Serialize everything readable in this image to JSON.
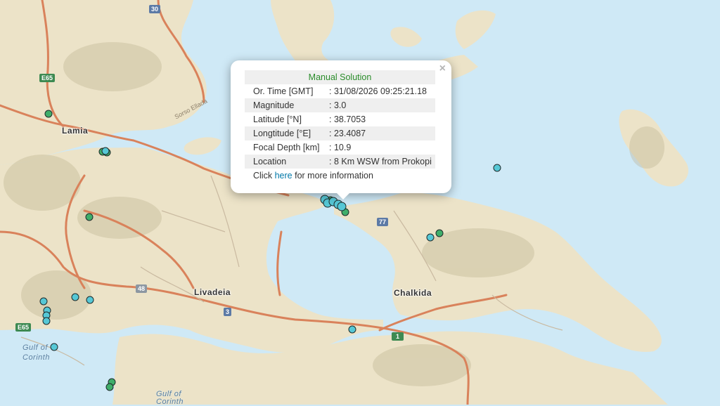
{
  "map": {
    "cities": [
      "Lamia",
      "Livadeia",
      "Chalkida"
    ],
    "water_labels": [
      "Gulf of",
      "Corinth",
      "Gulf of",
      "Corinth"
    ],
    "road_shields": [
      "30",
      "E65",
      "77",
      "3",
      "48",
      "E65",
      "1"
    ],
    "road_labels": [
      "Sorso Ellada"
    ],
    "marker_colors": {
      "green": "#3fae6a",
      "cyan": "#56c8d6"
    }
  },
  "popup": {
    "title": "Manual Solution",
    "close": "×",
    "rows": [
      {
        "label": "Or. Time [GMT]",
        "value": ": 31/08/2026 09:25:21.18"
      },
      {
        "label": "Magnitude",
        "value": ": 3.0"
      },
      {
        "label": "Latitude [°N]",
        "value": ": 38.7053"
      },
      {
        "label": "Longtitude [°E]",
        "value": ": 23.4087"
      },
      {
        "label": "Focal Depth [km]",
        "value": ": 10.9"
      },
      {
        "label": "Location",
        "value": ": 8 Km WSW from Prokopi"
      }
    ],
    "more_prefix": "Click",
    "more_link": "here",
    "more_suffix": "for more information"
  }
}
